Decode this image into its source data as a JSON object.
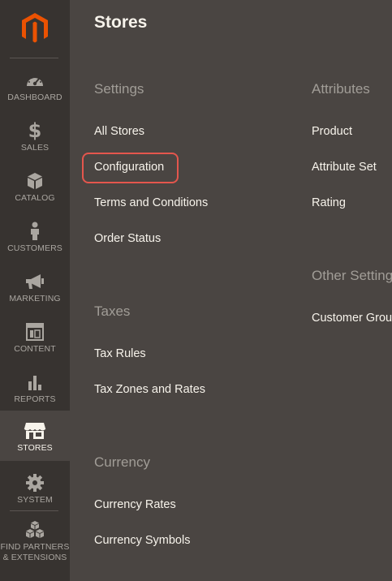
{
  "sidebar": {
    "items": [
      {
        "label": "DASHBOARD",
        "icon": "dashboard-icon"
      },
      {
        "label": "SALES",
        "icon": "dollar-icon"
      },
      {
        "label": "CATALOG",
        "icon": "box-icon"
      },
      {
        "label": "CUSTOMERS",
        "icon": "person-icon"
      },
      {
        "label": "MARKETING",
        "icon": "megaphone-icon"
      },
      {
        "label": "CONTENT",
        "icon": "layout-icon"
      },
      {
        "label": "REPORTS",
        "icon": "bar-chart-icon"
      },
      {
        "label": "STORES",
        "icon": "storefront-icon"
      },
      {
        "label": "SYSTEM",
        "icon": "gear-icon"
      },
      {
        "label_line1": "FIND PARTNERS",
        "label_line2": "& EXTENSIONS",
        "icon": "cubes-icon"
      }
    ],
    "active": "STORES"
  },
  "main": {
    "title": "Stores",
    "settings": {
      "title": "Settings",
      "links": [
        "All Stores",
        "Configuration",
        "Terms and Conditions",
        "Order Status"
      ]
    },
    "taxes": {
      "title": "Taxes",
      "links": [
        "Tax Rules",
        "Tax Zones and Rates"
      ]
    },
    "currency": {
      "title": "Currency",
      "links": [
        "Currency Rates",
        "Currency Symbols"
      ]
    },
    "attributes": {
      "title": "Attributes",
      "links": [
        "Product",
        "Attribute Set",
        "Rating"
      ]
    },
    "other_settings": {
      "title": "Other Settings",
      "links": [
        "Customer Groups"
      ]
    }
  },
  "colors": {
    "sidebar_bg": "#373330",
    "main_bg": "#4a4542",
    "brand_orange": "#eb5202",
    "highlight": "#e4564d"
  }
}
